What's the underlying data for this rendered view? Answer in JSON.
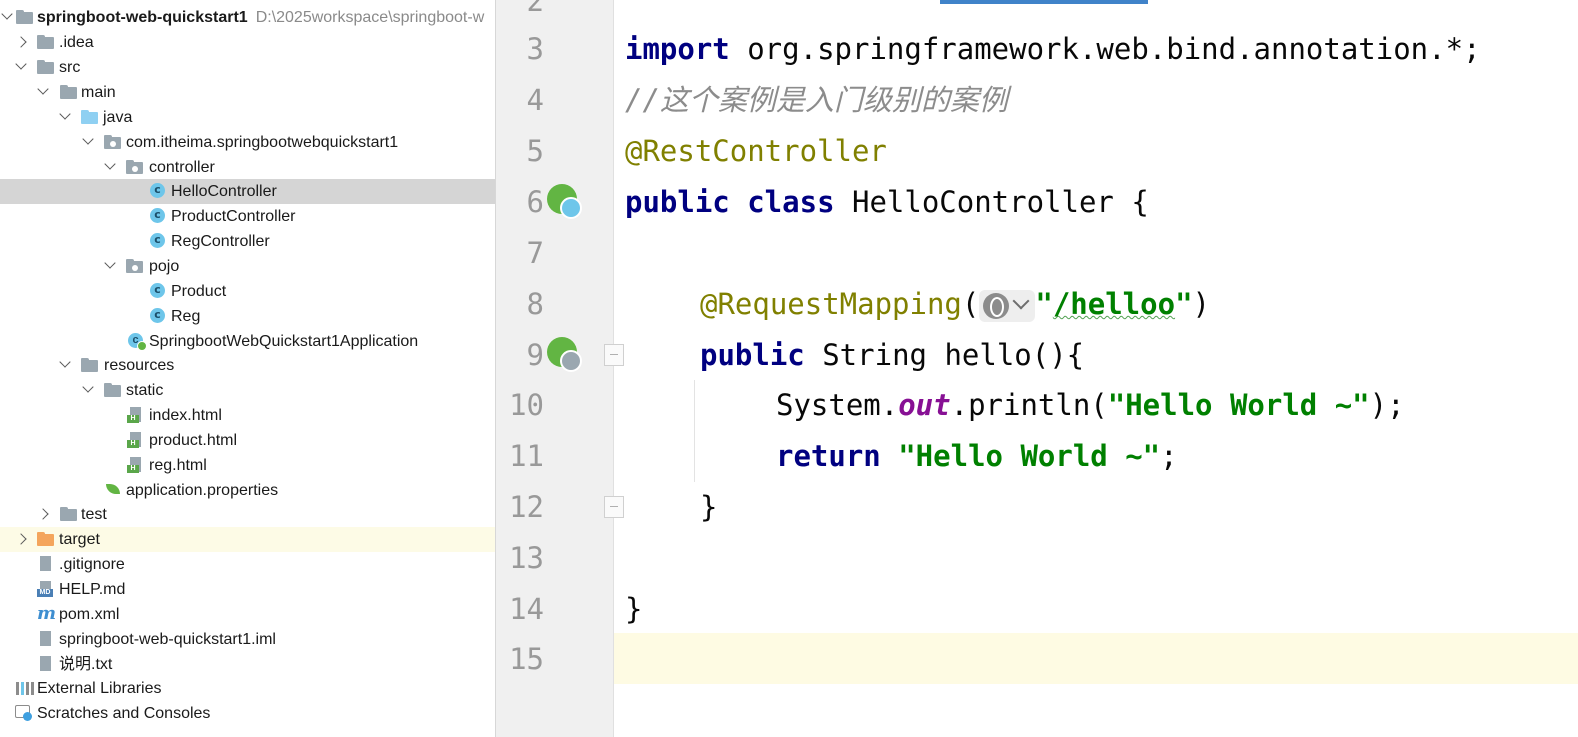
{
  "project_tree": {
    "root": {
      "label": "springboot-web-quickstart1",
      "path": "D:\\2025workspace\\springboot-w"
    },
    "items": [
      {
        "label": ".idea"
      },
      {
        "label": "src"
      },
      {
        "label": "main"
      },
      {
        "label": "java"
      },
      {
        "label": "com.itheima.springbootwebquickstart1"
      },
      {
        "label": "controller"
      },
      {
        "label": "HelloController"
      },
      {
        "label": "ProductController"
      },
      {
        "label": "RegController"
      },
      {
        "label": "pojo"
      },
      {
        "label": "Product"
      },
      {
        "label": "Reg"
      },
      {
        "label": "SpringbootWebQuickstart1Application"
      },
      {
        "label": "resources"
      },
      {
        "label": "static"
      },
      {
        "label": "index.html"
      },
      {
        "label": "product.html"
      },
      {
        "label": "reg.html"
      },
      {
        "label": "application.properties"
      },
      {
        "label": "test"
      },
      {
        "label": "target"
      },
      {
        "label": ".gitignore"
      },
      {
        "label": "HELP.md"
      },
      {
        "label": "pom.xml"
      },
      {
        "label": "springboot-web-quickstart1.iml"
      },
      {
        "label": "说明.txt"
      },
      {
        "label": "External Libraries"
      },
      {
        "label": "Scratches and Consoles"
      }
    ],
    "badges": {
      "html": "H",
      "md": "MD",
      "maven": "m"
    }
  },
  "editor": {
    "line_numbers": [
      "2",
      "3",
      "4",
      "5",
      "6",
      "7",
      "8",
      "9",
      "10",
      "11",
      "12",
      "13",
      "14",
      "15"
    ],
    "code": {
      "l3_kw": "import",
      "l3_rest": " org.springframework.web.bind.annotation.*;",
      "l4_comment": "//这个案例是入门级别的案例",
      "l5_ann": "@RestController",
      "l6_kw1": "public",
      "l6_kw2": " class",
      "l6_rest": " HelloController {",
      "l8_ann": "@RequestMapping",
      "l8_paren": "(",
      "l8_q1": "\"",
      "l8_str": "/helloo",
      "l8_q2": "\"",
      "l8_close": ")",
      "l9_kw": "public",
      "l9_rest": " String hello(){",
      "l10_pre": "System.",
      "l10_field": "out",
      "l10_mid": ".println(",
      "l10_str": "\"Hello World ~\"",
      "l10_end": ");",
      "l11_kw": "return",
      "l11_str": " \"Hello World ~\"",
      "l11_end": ";",
      "l12": "}",
      "l14": "}"
    }
  },
  "colors": {
    "keyword": "#000080",
    "annotation": "#808000",
    "string": "#008000",
    "comment": "#8c8c8c",
    "field": "#871094",
    "selection": "#d5d5d5",
    "current_line": "#fefbe3",
    "spring_green": "#62b543"
  }
}
